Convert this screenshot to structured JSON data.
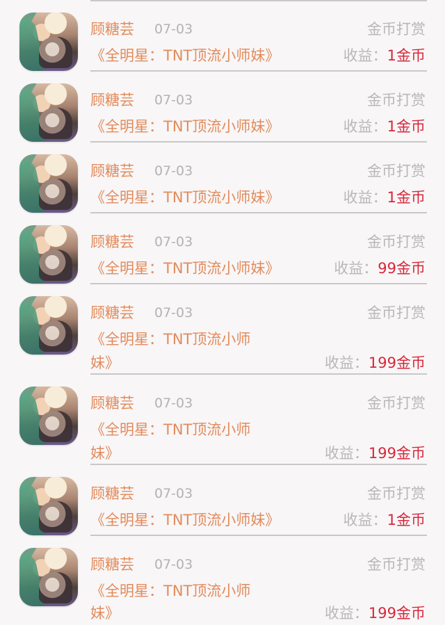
{
  "items": [
    {
      "avatar": "girl-avatar-icon",
      "name": "顾糖芸",
      "date": "07-03",
      "type": "金币打赏",
      "title_line1": "《全明星：TNT顶流小师妹》",
      "title_line2": "",
      "income_label": "收益：",
      "income_value": "1金币"
    },
    {
      "avatar": "girl-avatar-icon",
      "name": "顾糖芸",
      "date": "07-03",
      "type": "金币打赏",
      "title_line1": "《全明星：TNT顶流小师妹》",
      "title_line2": "",
      "income_label": "收益：",
      "income_value": "1金币"
    },
    {
      "avatar": "girl-avatar-icon",
      "name": "顾糖芸",
      "date": "07-03",
      "type": "金币打赏",
      "title_line1": "《全明星：TNT顶流小师妹》",
      "title_line2": "",
      "income_label": "收益：",
      "income_value": "1金币"
    },
    {
      "avatar": "girl-avatar-icon",
      "name": "顾糖芸",
      "date": "07-03",
      "type": "金币打赏",
      "title_line1": "《全明星：TNT顶流小师妹》",
      "title_line2": "",
      "income_label": "收益：",
      "income_value": "99金币"
    },
    {
      "avatar": "girl-avatar-icon",
      "name": "顾糖芸",
      "date": "07-03",
      "type": "金币打赏",
      "title_line1": "《全明星：TNT顶流小师",
      "title_line2": "妹》",
      "income_label": "收益：",
      "income_value": "199金币"
    },
    {
      "avatar": "girl-avatar-icon",
      "name": "顾糖芸",
      "date": "07-03",
      "type": "金币打赏",
      "title_line1": "《全明星：TNT顶流小师",
      "title_line2": "妹》",
      "income_label": "收益：",
      "income_value": "199金币"
    },
    {
      "avatar": "girl-avatar-icon",
      "name": "顾糖芸",
      "date": "07-03",
      "type": "金币打赏",
      "title_line1": "《全明星：TNT顶流小师妹》",
      "title_line2": "",
      "income_label": "收益：",
      "income_value": "1金币"
    },
    {
      "avatar": "girl-avatar-icon",
      "name": "顾糖芸",
      "date": "07-03",
      "type": "金币打赏",
      "title_line1": "《全明星：TNT顶流小师",
      "title_line2": "妹》",
      "income_label": "收益：",
      "income_value": "199金币"
    }
  ]
}
